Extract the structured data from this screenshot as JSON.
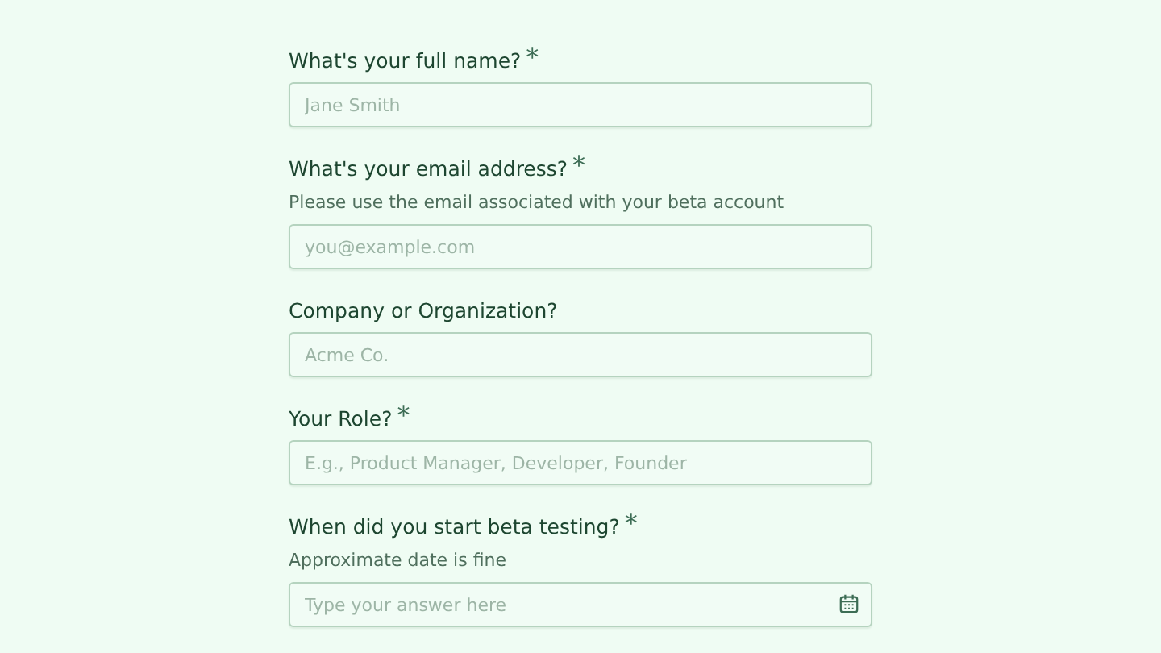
{
  "fields": [
    {
      "kind": "text",
      "label": "What's your full name?",
      "required_mark": "*",
      "placeholder": "Jane Smith"
    },
    {
      "kind": "text",
      "label": "What's your email address?",
      "required_mark": "*",
      "hint": "Please use the email associated with your beta account",
      "placeholder": "you@example.com"
    },
    {
      "kind": "text",
      "label": "Company or Organization?",
      "placeholder": "Acme Co."
    },
    {
      "kind": "text",
      "label": "Your Role?",
      "required_mark": "*",
      "placeholder": "E.g., Product Manager, Developer, Founder"
    },
    {
      "kind": "date",
      "label": "When did you start beta testing?",
      "required_mark": "*",
      "hint": "Approximate date is fine",
      "placeholder": "Type your answer here"
    }
  ]
}
